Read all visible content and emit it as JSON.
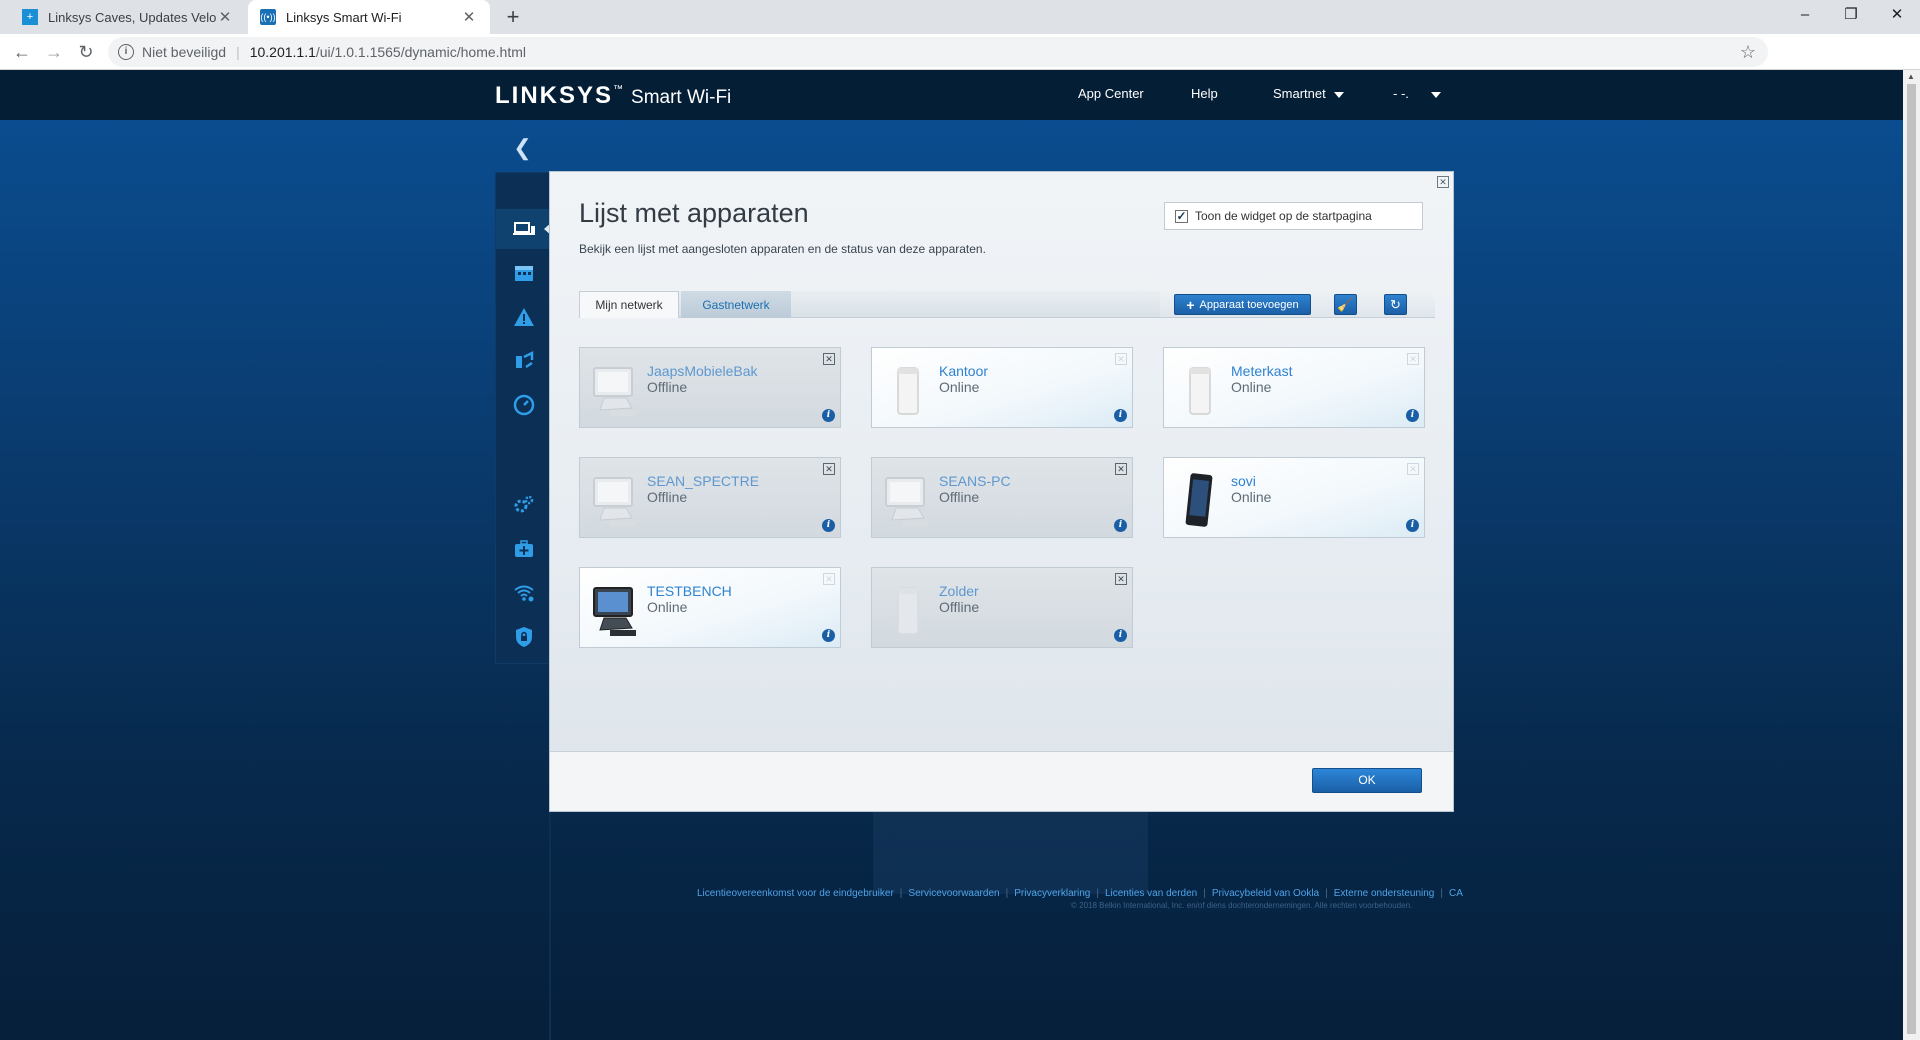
{
  "browser": {
    "tabs": [
      {
        "title": "Linksys Caves, Updates Velop Wi-",
        "favicon": "plus-favicon"
      },
      {
        "title": "Linksys Smart Wi-Fi",
        "favicon": "wifi-favicon"
      }
    ],
    "security_label": "Niet beveiligd",
    "url_host": "10.201.1.1",
    "url_path": "/ui/1.0.1.1565/dynamic/home.html"
  },
  "header": {
    "brand": "LINKSYS",
    "brand_tm": "™",
    "product": "Smart Wi-Fi",
    "links": [
      "App Center",
      "Help"
    ],
    "network_menu": "Smartnet",
    "user_menu": "- -."
  },
  "modal": {
    "title": "Lijst met apparaten",
    "description": "Bekijk een lijst met aangesloten apparaten en de status van deze apparaten.",
    "widget_label": "Toon de widget op de startpagina",
    "widget_checked": "✓",
    "tabs": [
      "Mijn netwerk",
      "Gastnetwerk"
    ],
    "add_device": "Apparaat toevoegen",
    "ok": "OK",
    "devices": [
      {
        "name": "JaapsMobieleBak",
        "status": "Offline",
        "icon": "desktop-computer-icon"
      },
      {
        "name": "Kantoor",
        "status": "Online",
        "icon": "velop-node-icon"
      },
      {
        "name": "Meterkast",
        "status": "Online",
        "icon": "velop-node-icon"
      },
      {
        "name": "SEAN_SPECTRE",
        "status": "Offline",
        "icon": "desktop-computer-icon"
      },
      {
        "name": "SEANS-PC",
        "status": "Offline",
        "icon": "desktop-computer-icon"
      },
      {
        "name": "sovi",
        "status": "Online",
        "icon": "smartphone-icon"
      },
      {
        "name": "TESTBENCH",
        "status": "Online",
        "icon": "desktop-computer-icon"
      },
      {
        "name": "Zolder",
        "status": "Offline",
        "icon": "velop-node-icon"
      }
    ]
  },
  "footer": {
    "links": [
      "Licentieovereenkomst voor de eindgebruiker",
      "Servicevoorwaarden",
      "Privacyverklaring",
      "Licenties van derden",
      "Privacybeleid van Ookla",
      "Externe ondersteuning",
      "CA"
    ],
    "copyright": "© 2018 Belkin International, Inc. en/of diens dochterondernemingen. Alle rechten voorbehouden."
  },
  "colors": {
    "link_blue": "#2f82cf",
    "button_blue": "#1a5fa6",
    "header_bg": "#041e35"
  }
}
